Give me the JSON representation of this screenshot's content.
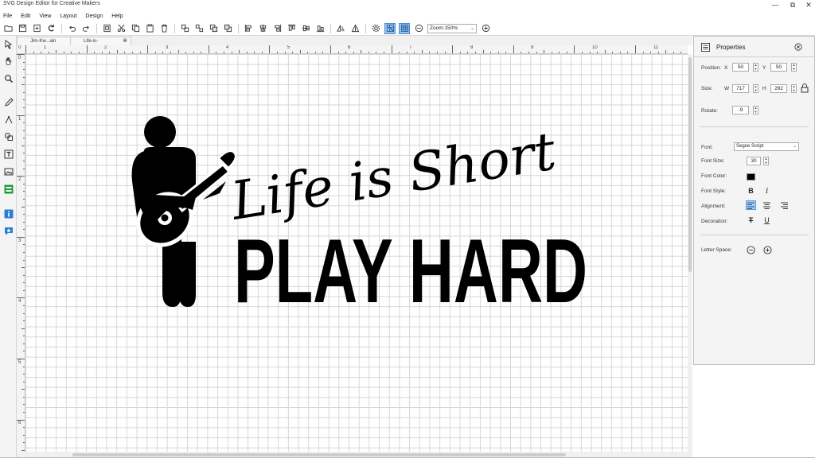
{
  "window": {
    "title": "SVG Design Editor for Creative Makers"
  },
  "menu": [
    "File",
    "Edit",
    "View",
    "Layout",
    "Design",
    "Help"
  ],
  "toolbar": {
    "zoom_value": "Zoom:150%"
  },
  "tabs": [
    {
      "label": "Jim-Kw...ain"
    },
    {
      "label": "Life-is-"
    }
  ],
  "rulers": {
    "horizontal": [
      "0",
      "1",
      "2",
      "3",
      "4",
      "5",
      "6",
      "7",
      "8",
      "9",
      "10",
      "11"
    ],
    "vertical": [
      "0",
      "1",
      "2",
      "3",
      "4",
      "5",
      "6"
    ]
  },
  "design": {
    "line1": "Life is Short",
    "line2": "PLAY HARD"
  },
  "properties": {
    "title": "Properties",
    "position_label": "Position:",
    "x_label": "X",
    "x_value": "50",
    "y_label": "Y",
    "y_value": "50",
    "size_label": "Size:",
    "w_label": "W",
    "w_value": "717",
    "h_label": "H",
    "h_value": "292",
    "rotate_label": "Rotate:",
    "rotate_value": "-9",
    "font_label": "Font:",
    "font_value": "Segoe Script",
    "font_size_label": "Font Size:",
    "font_size_value": "30",
    "font_color_label": "Font Color:",
    "font_color_value": "#000000",
    "font_style_label": "Font Style:",
    "bold_glyph": "B",
    "italic_glyph": "I",
    "alignment_label": "Alignment:",
    "decoration_label": "Decoration:",
    "strike_glyph": "T",
    "underline_glyph": "U",
    "letter_space_label": "Letter Space:"
  }
}
